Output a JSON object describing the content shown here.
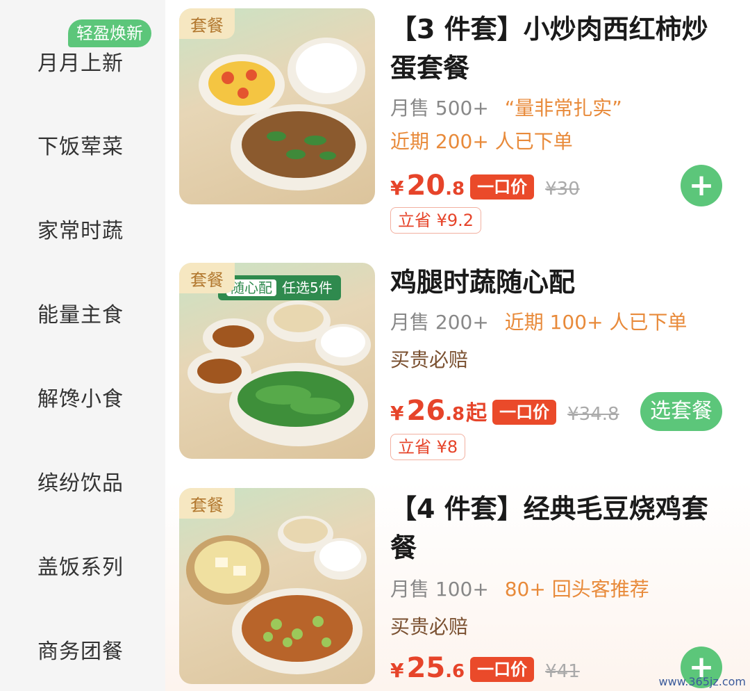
{
  "sidebar": {
    "badge": "轻盈焕新",
    "items": [
      {
        "label": "月月上新"
      },
      {
        "label": "下饭荤菜"
      },
      {
        "label": "家常时蔬"
      },
      {
        "label": "能量主食"
      },
      {
        "label": "解馋小食"
      },
      {
        "label": "缤纷饮品"
      },
      {
        "label": "盖饭系列"
      },
      {
        "label": "商务团餐"
      }
    ]
  },
  "products": [
    {
      "tag": "套餐",
      "title": "【3 件套】小炒肉西红柿炒蛋套餐",
      "sales": "月售 500+",
      "quote": "“量非常扎实”",
      "recent": "近期 200+ 人已下单",
      "price_symbol": "¥",
      "price_int": "20",
      "price_dec": ".8",
      "one_price": "一口价",
      "original": "¥30",
      "save": "立省 ¥9.2",
      "action": "+"
    },
    {
      "tag": "套餐",
      "banner_hl": "随心配",
      "banner_text": "任选5件",
      "title": "鸡腿时蔬随心配",
      "sales": "月售 200+",
      "recent": "近期 100+ 人已下单",
      "guarantee": "买贵必赔",
      "price_symbol": "¥",
      "price_int": "26",
      "price_dec": ".8",
      "price_suffix": "起",
      "one_price": "一口价",
      "original": "¥34.8",
      "save": "立省 ¥8",
      "action": "选套餐"
    },
    {
      "tag": "套餐",
      "title": "【4 件套】经典毛豆烧鸡套餐",
      "sales": "月售 100+",
      "recommend": "80+ 回头客推荐",
      "guarantee": "买贵必赔",
      "price_symbol": "¥",
      "price_int": "25",
      "price_dec": ".6",
      "one_price": "一口价",
      "original": "¥41",
      "action": "+"
    }
  ],
  "watermark": "www.365jz.com",
  "colors": {
    "accent_green": "#5cc67a",
    "price_red": "#e6442a",
    "highlight_orange": "#e88a3a"
  }
}
